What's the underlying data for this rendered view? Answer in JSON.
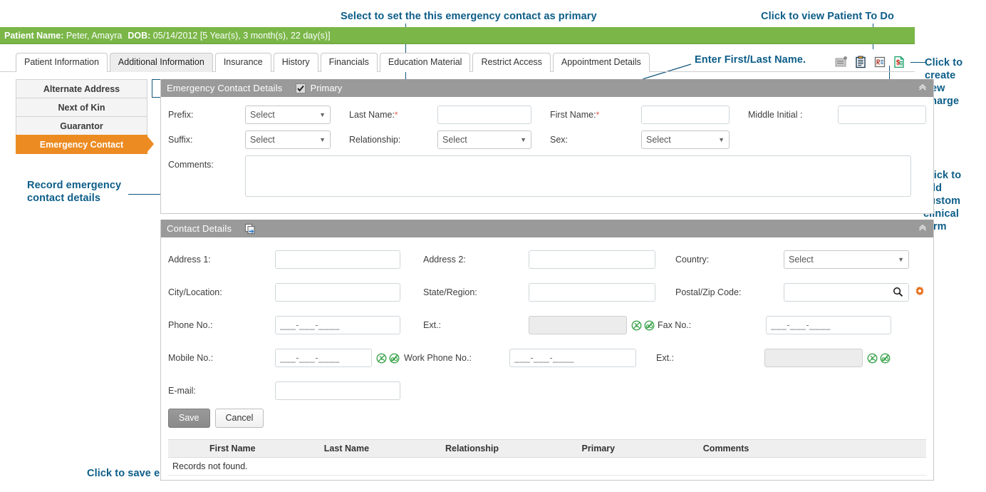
{
  "patient_bar": {
    "name_label": "Patient Name:",
    "name_value": "Peter, Amayra",
    "dob_label": "DOB:",
    "dob_value": "05/14/2012 [5 Year(s), 3 month(s), 22 day(s)]"
  },
  "tabs": [
    {
      "label": "Patient Information",
      "active": false
    },
    {
      "label": "Additional Information",
      "active": true
    },
    {
      "label": "Insurance",
      "active": false
    },
    {
      "label": "History",
      "active": false
    },
    {
      "label": "Financials",
      "active": false
    },
    {
      "label": "Education Material",
      "active": false
    },
    {
      "label": "Restrict Access",
      "active": false
    },
    {
      "label": "Appointment Details",
      "active": false
    }
  ],
  "toolbar_icons": [
    {
      "name": "patient-document-icon",
      "title": "Patient Document"
    },
    {
      "name": "patient-todo-clipboard-icon",
      "title": "Patient To Do"
    },
    {
      "name": "custom-clinical-form-icon",
      "title": "Custom Clinical Form"
    },
    {
      "name": "new-charge-icon",
      "title": "Create New Charge"
    }
  ],
  "sidenav": {
    "items": [
      {
        "label": "Alternate Address",
        "active": false
      },
      {
        "label": "Next of Kin",
        "active": false
      },
      {
        "label": "Guarantor",
        "active": false
      },
      {
        "label": "Emergency Contact",
        "active": true
      }
    ]
  },
  "emergency_panel": {
    "title": "Emergency Contact Details",
    "primary_label": "Primary",
    "primary_checked": true,
    "collapse_icon": "chevron-up-icon",
    "fields": {
      "prefix_label": "Prefix:",
      "prefix_value": "Select",
      "suffix_label": "Suffix:",
      "suffix_value": "Select",
      "comments_label": "Comments:",
      "comments_value": "",
      "last_name_label": "Last Name:",
      "last_name_value": "",
      "relationship_label": "Relationship:",
      "relationship_value": "Select",
      "first_name_label": "First Name:",
      "first_name_value": "",
      "sex_label": "Sex:",
      "sex_value": "Select",
      "middle_initial_label": "Middle Initial :",
      "middle_initial_value": ""
    }
  },
  "contact_panel": {
    "title": "Contact Details",
    "copy_icon": "copy-from-patient-icon",
    "collapse_icon": "chevron-up-icon",
    "fields": {
      "address1_label": "Address 1:",
      "address1_value": "",
      "address2_label": "Address 2:",
      "address2_value": "",
      "country_label": "Country:",
      "country_value": "Select",
      "city_label": "City/Location:",
      "city_value": "",
      "state_label": "State/Region:",
      "state_value": "",
      "postal_label": "Postal/Zip Code:",
      "postal_value": "",
      "phone_label": "Phone No.:",
      "phone_value": "___-___-____",
      "ext1_label": "Ext.:",
      "ext1_value": "",
      "fax_label": "Fax No.:",
      "fax_value": "___-___-____",
      "mobile_label": "Mobile No.:",
      "mobile_value": "___-___-____",
      "work_phone_label": "Work Phone No.:",
      "work_phone_value": "___-___-____",
      "ext2_label": "Ext.:",
      "ext2_value": "",
      "email_label": "E-mail:",
      "email_value": ""
    }
  },
  "buttons": {
    "save": "Save",
    "cancel": "Cancel"
  },
  "results_table": {
    "columns": [
      "First Name",
      "Last Name",
      "Relationship",
      "Primary",
      "Comments"
    ],
    "empty_message": "Records not found."
  },
  "annotations": {
    "primary": "Select to set the this emergency contact as primary",
    "patient_todo": "Click to view Patient To Do",
    "enter_names": "Enter First/Last Name.",
    "new_charge": "Click to\ncreate\nnew\ncharge",
    "record_details": "Record emergency\ncontact details",
    "custom_form": "Click to\nadd\ncustom\nclinical\nform",
    "save_details": "Click to save emergency contact details"
  },
  "colors": {
    "patient_bar_green": "#7ab648",
    "active_nav_orange": "#ec8b22",
    "panel_header_grey": "#9a9a9a",
    "annotation_blue": "#0c5d88",
    "required_red": "#e2574c",
    "nocall_green": "#2f9e41"
  }
}
